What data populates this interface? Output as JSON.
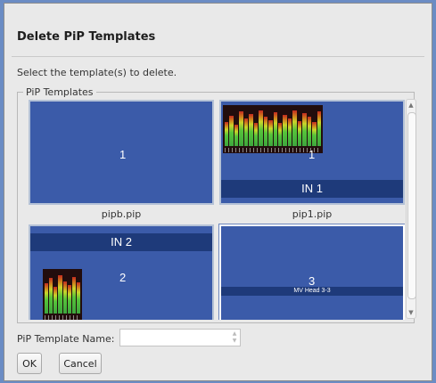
{
  "dialog": {
    "title": "Delete PiP Templates",
    "instructions": "Select the template(s) to delete."
  },
  "templates_group": {
    "legend": "PiP Templates",
    "tiles": [
      {
        "number": "1",
        "caption": "pipb.pip",
        "selected": false,
        "input_label": ""
      },
      {
        "number": "1",
        "caption": "pip1.pip",
        "selected": false,
        "input_label": "IN 1"
      },
      {
        "number": "2",
        "caption": "",
        "selected": false,
        "input_label": "IN 2"
      },
      {
        "number": "3",
        "caption": "",
        "selected": true,
        "input_label": "MV Head 3-3"
      }
    ],
    "meter_scale_1": "2 3 4 5 6 7 8 9 1 0 1 1 1",
    "meter_scale_1b": "9 2 3 4 5 6",
    "meter_scale_2": "2 3 4 5 6 7 8"
  },
  "name_field": {
    "label": "PiP Template Name:",
    "value": ""
  },
  "buttons": {
    "ok": "OK",
    "cancel": "Cancel"
  },
  "colors": {
    "tile_background": "#3b5ba9",
    "input_bar": "#1e3a7a",
    "selected_border": "#ffffff"
  }
}
